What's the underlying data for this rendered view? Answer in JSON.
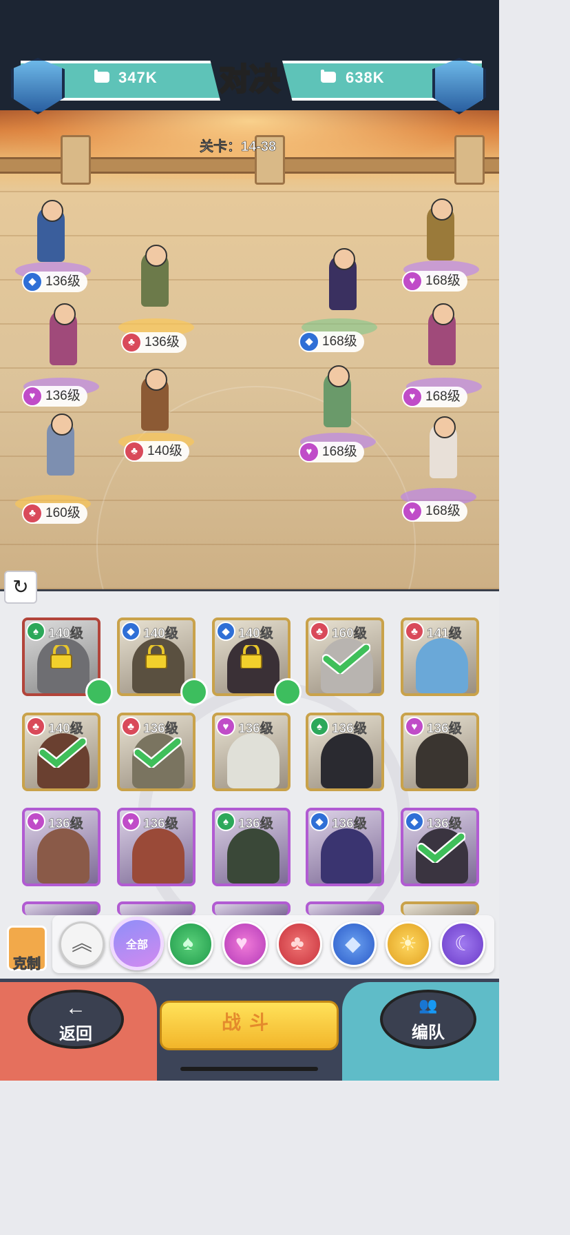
{
  "header": {
    "title": "对决",
    "left_power": "347K",
    "right_power": "638K",
    "stage_label": "关卡：14-38"
  },
  "battlefield": {
    "left_team": [
      {
        "level": "136级",
        "element": "blue"
      },
      {
        "level": "136级",
        "element": "red"
      },
      {
        "level": "136级",
        "element": "pink"
      },
      {
        "level": "140级",
        "element": "red"
      },
      {
        "level": "160级",
        "element": "red"
      }
    ],
    "right_team": [
      {
        "level": "168级",
        "element": "pink"
      },
      {
        "level": "168级",
        "element": "blue"
      },
      {
        "level": "168级",
        "element": "pink"
      },
      {
        "level": "168级",
        "element": "pink"
      },
      {
        "level": "168级",
        "element": "pink"
      }
    ]
  },
  "roster": [
    {
      "level": "140级",
      "element": "green",
      "rarity": "red",
      "locked": true,
      "selected": false,
      "friend": true
    },
    {
      "level": "140级",
      "element": "blue",
      "rarity": "gold",
      "locked": true,
      "selected": false,
      "friend": true
    },
    {
      "level": "140级",
      "element": "blue",
      "rarity": "gold",
      "locked": true,
      "selected": false,
      "friend": true
    },
    {
      "level": "160级",
      "element": "red",
      "rarity": "gold",
      "locked": false,
      "selected": true,
      "friend": false
    },
    {
      "level": "141级",
      "element": "red",
      "rarity": "gold",
      "locked": false,
      "selected": false,
      "friend": false
    },
    {
      "level": "140级",
      "element": "red",
      "rarity": "gold",
      "locked": false,
      "selected": true,
      "friend": false
    },
    {
      "level": "136级",
      "element": "red",
      "rarity": "gold",
      "locked": false,
      "selected": true,
      "friend": false
    },
    {
      "level": "136级",
      "element": "pink",
      "rarity": "gold",
      "locked": false,
      "selected": false,
      "friend": false
    },
    {
      "level": "136级",
      "element": "green",
      "rarity": "gold",
      "locked": false,
      "selected": false,
      "friend": false
    },
    {
      "level": "136级",
      "element": "pink",
      "rarity": "gold",
      "locked": false,
      "selected": false,
      "friend": false
    },
    {
      "level": "136级",
      "element": "pink",
      "rarity": "purple",
      "locked": false,
      "selected": false,
      "friend": false
    },
    {
      "level": "136级",
      "element": "pink",
      "rarity": "purple",
      "locked": false,
      "selected": false,
      "friend": false
    },
    {
      "level": "136级",
      "element": "green",
      "rarity": "purple",
      "locked": false,
      "selected": false,
      "friend": false
    },
    {
      "level": "136级",
      "element": "blue",
      "rarity": "purple",
      "locked": false,
      "selected": false,
      "friend": false
    },
    {
      "level": "136级",
      "element": "blue",
      "rarity": "purple",
      "locked": false,
      "selected": true,
      "friend": false
    }
  ],
  "filters": {
    "kezhi_label": "克制",
    "all_label": "全部",
    "items": [
      "collapse",
      "all",
      "green",
      "pink",
      "red",
      "blue",
      "sun",
      "moon"
    ]
  },
  "controls": {
    "back_label": "返回",
    "fight_label": "战斗",
    "team_label": "编队"
  },
  "colors": {
    "blue": "#2f6fd6",
    "red": "#d94a5a",
    "pink": "#c04cc8",
    "green": "#2ca85a",
    "accent_teal": "#5ec3b8",
    "fight_yellow": "#f2b52a"
  }
}
